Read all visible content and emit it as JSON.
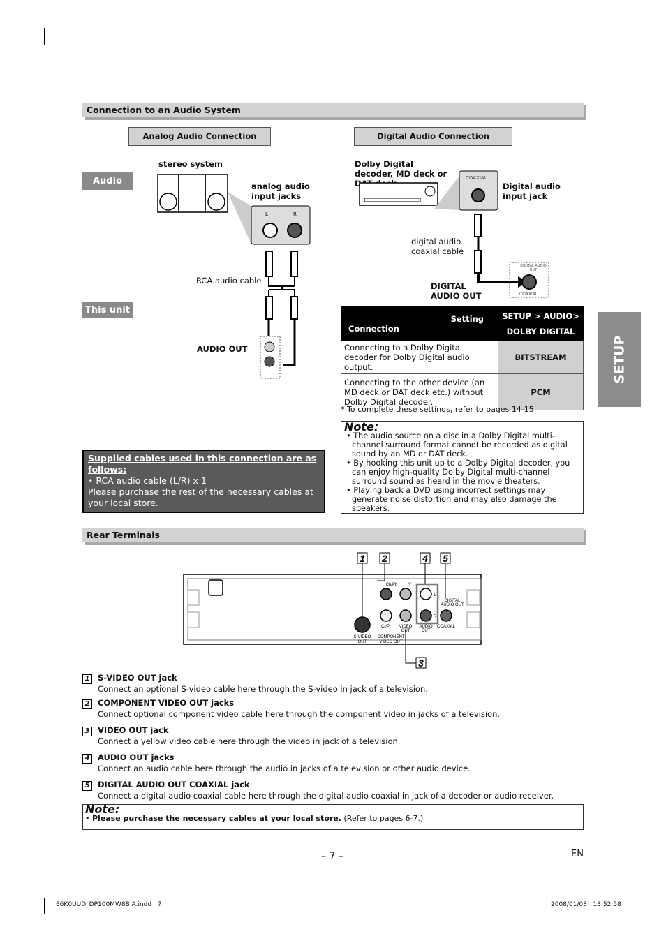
{
  "section1": {
    "title": "Connection to an Audio System",
    "analog_title": "Analog Audio Connection",
    "digital_title": "Digital Audio Connection"
  },
  "analog": {
    "audio_tag": "Audio",
    "unit_tag": "This unit",
    "stereo_label": "stereo system",
    "input_label": "analog audio input jacks",
    "jack_l": "L",
    "jack_r": "R",
    "cable_label": "RCA audio cable",
    "audio_out": "AUDIO OUT",
    "unit_jack_label": "AUDIO OUT"
  },
  "digital": {
    "decoder_label": "Dolby Digital decoder, MD deck or DAT deck",
    "coaxial": "COAXIAL",
    "input_label": "Digital audio input jack",
    "cable_label": "digital audio coaxial cable",
    "out_label": "DIGITAL AUDIO OUT",
    "unit_jack_top": "DIGITAL AUDIO OUT",
    "unit_jack_bottom": "COAXIAL"
  },
  "settings_table": {
    "header_setting": "Setting",
    "header_connection": "Connection",
    "header_menu_1": "SETUP > AUDIO>",
    "header_menu_2": "DOLBY DIGITAL",
    "rows": [
      {
        "connection": "Connecting to a Dolby Digital decoder for Dolby Digital audio output.",
        "value": "BITSTREAM"
      },
      {
        "connection": "Connecting to the other device (an MD deck or DAT deck etc.) without Dolby Digital decoder.",
        "value": "PCM"
      }
    ],
    "footnote": "* To complete these settings, refer to pages 14-15."
  },
  "note1": {
    "title": "Note:",
    "items": [
      "The audio source on a disc in a Dolby Digital multi-channel surround format cannot be recorded as digital sound by an MD or DAT deck.",
      "By hooking this unit up to a Dolby Digital decoder, you can enjoy high-quality Dolby Digital multi-channel surround sound as heard in the movie theaters.",
      "Playing back a DVD using incorrect settings may generate noise distortion and may also damage the speakers."
    ]
  },
  "supplied": {
    "title": "Supplied cables used in this connection are as follows:",
    "item": "• RCA audio cable (L/R) x 1",
    "text": "Please purchase the rest of the necessary cables at your local store."
  },
  "side_tab": "SETUP",
  "section2": {
    "title": "Rear Terminals"
  },
  "panel": {
    "callouts": [
      "1",
      "2",
      "3",
      "4",
      "5"
    ],
    "labels": {
      "cb": "Cb/Pb",
      "y": "Y",
      "cr": "Cr/Pr",
      "l": "L",
      "r": "R",
      "svideo": "S-VIDEO OUT",
      "component": "COMPONENT VIDEO OUT",
      "video": "VIDEO OUT",
      "audio": "AUDIO OUT",
      "digital": "DIGITAL AUDIO OUT",
      "coaxial": "COAXIAL"
    }
  },
  "terminals": [
    {
      "num": "1",
      "title": "S-VIDEO OUT jack",
      "desc": "Connect an optional S-video cable here through the S-video in jack of a television."
    },
    {
      "num": "2",
      "title": "COMPONENT VIDEO OUT jacks",
      "desc": "Connect optional component video cable here through the component video in jacks of a television."
    },
    {
      "num": "3",
      "title": "VIDEO OUT jack",
      "desc": "Connect a yellow video cable here through the video in jack of a television."
    },
    {
      "num": "4",
      "title": "AUDIO OUT jacks",
      "desc": "Connect an audio cable here through the audio in jacks of a television or other audio device."
    },
    {
      "num": "5",
      "title": "DIGITAL AUDIO OUT COAXIAL jack",
      "desc": "Connect a digital audio coaxial cable here through the digital audio coaxial in jack of a decoder or audio receiver."
    }
  ],
  "note2": {
    "title": "Note:",
    "bold": "Please purchase the necessary cables at your local store.",
    "rest": " (Refer to pages 6-7.)"
  },
  "page_number": "– 7 –",
  "language": "EN",
  "footer": {
    "file": "E6K0UUD_DP100MW8B A.indd   7",
    "date": "2008/01/08   13:52:58"
  }
}
